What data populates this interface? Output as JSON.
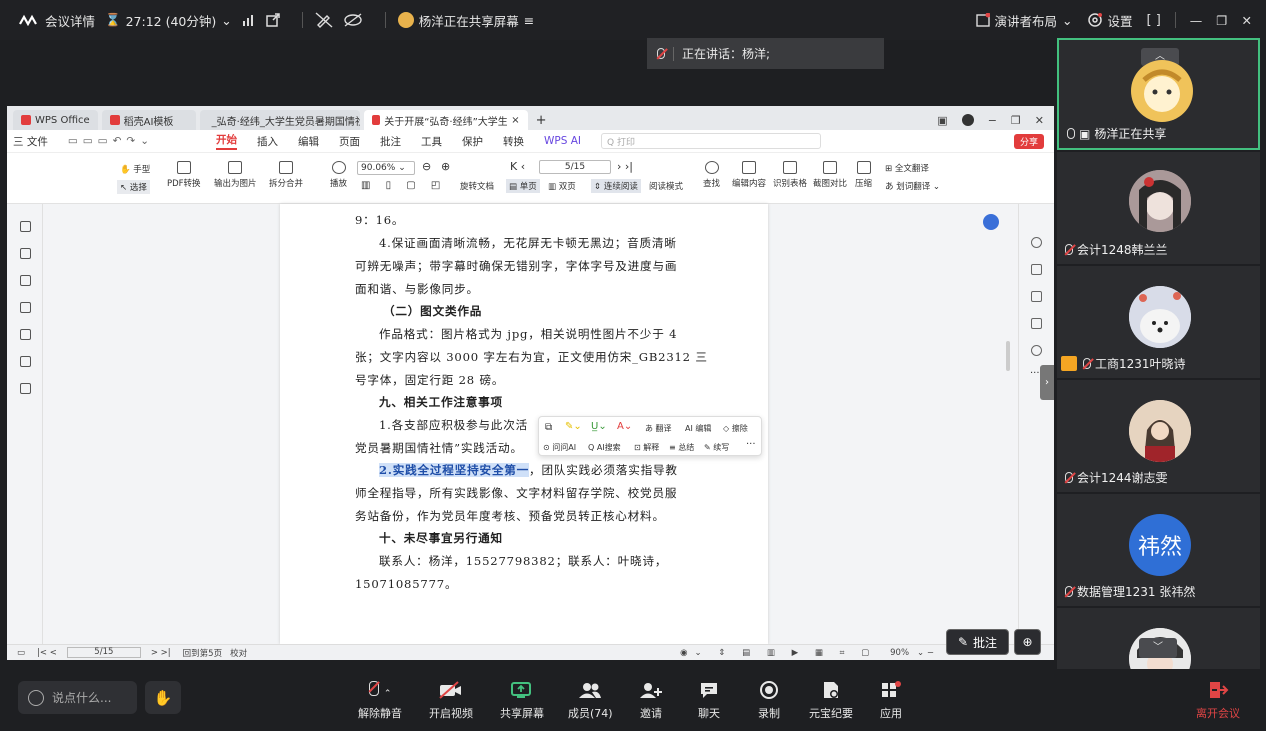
{
  "topbar": {
    "meeting_details": "会议详情",
    "timer": "27:12 (40分钟)",
    "sharing_status": "杨洋正在共享屏幕",
    "layout_label": "演讲者布局",
    "settings_label": "设置"
  },
  "speaking": {
    "label": "正在讲话：杨洋;"
  },
  "wps": {
    "tabs": [
      {
        "label": "WPS Office",
        "color": "#e23c3c"
      },
      {
        "label": "稻壳AI模板",
        "color": "#e23c3c"
      },
      {
        "label": "_弘奇·经纬_大学生党员暑期国情社会",
        "color": "#e86a1a"
      },
      {
        "label": "关于开展“弘奇·经纬”大学生党员",
        "color": "#e23c3c"
      }
    ],
    "menu": [
      "三 文件",
      "开始",
      "插入",
      "编辑",
      "页面",
      "批注",
      "工具",
      "保护",
      "转换",
      "WPS AI"
    ],
    "search_placeholder": "Q 打印",
    "share_label": "分享",
    "ribbon": {
      "hand": "手型",
      "select": "选择",
      "pdf_convert": "PDF转换",
      "export_image": "输出为图片",
      "split_merge": "拆分合并",
      "play": "播放",
      "zoom": "90.06%",
      "page": "5/15",
      "rotate": "旋转文档",
      "single": "单页",
      "double": "双页",
      "continuous": "连续阅读",
      "read_mode": "阅读模式",
      "find": "查找",
      "edit_content": "编辑内容",
      "recognize_table": "识别表格",
      "compare": "截图对比",
      "compress": "压缩",
      "full_translate": "全文翻译",
      "word_translate": "划词翻译"
    },
    "doc": {
      "l1": "9：16。",
      "l2": "4.保证画面清晰流畅，无花屏无卡顿无黑边；音质清晰",
      "l3": "可辨无噪声；带字幕时确保无错别字，字体字号及进度与画",
      "l4": "面和谐、与影像同步。",
      "l5": "（二）图文类作品",
      "l6": "作品格式：图片格式为 jpg，相关说明性图片不少于 4",
      "l7": "张；文字内容以 3000 字左右为宜，正文使用仿宋_GB2312 三",
      "l8": "号字体，固定行距 28 磅。",
      "l9": "九、相关工作注意事项",
      "l10": "1.各支部应积极参与此次活",
      "l11": "党员暑期国情社情”实践活动。",
      "l12_hl": "2.实践全过程坚持安全第一",
      "l12_rest": "，团队实践必须落实指导教",
      "l13": "师全程指导，所有实践影像、文字材料留存学院、校党员服",
      "l14": "务站备份，作为党员年度考核、预备党员转正核心材料。",
      "l15": "十、未尽事宜另行通知",
      "l16": "联系人：杨洋，15527798382；联系人：叶晓诗，",
      "l17": "15071085777。"
    },
    "popup": {
      "translate": "翻译",
      "edit": "编辑",
      "erase": "擦除",
      "ask_ai": "问问AI",
      "ai_search": "AI搜索",
      "explain": "解释",
      "summary": "总结",
      "continue": "续写"
    },
    "status": {
      "page": "5/15",
      "back": "回到第5页",
      "proofread": "校对",
      "zoom": "90%"
    }
  },
  "annotate_label": "批注",
  "participants": [
    {
      "name": "杨洋正在共享",
      "initials": ""
    },
    {
      "name": "会计1248韩兰兰",
      "initials": ""
    },
    {
      "name": "工商1231叶晓诗",
      "initials": ""
    },
    {
      "name": "会计1244谢志雯",
      "initials": ""
    },
    {
      "name": "数据管理1231 张祎然",
      "initials": "祎然"
    }
  ],
  "bottombar": {
    "chat_placeholder": "说点什么...",
    "unmute": "解除静音",
    "start_video": "开启视频",
    "share_screen": "共享屏幕",
    "members": "成员(74)",
    "invite": "邀请",
    "chat": "聊天",
    "record": "录制",
    "notes": "元宝纪要",
    "apps": "应用",
    "leave": "离开会议"
  },
  "colors": {
    "accent_red": "#e04545",
    "share_green": "#43c07f",
    "avatar_blue": "#2f6fd6"
  }
}
